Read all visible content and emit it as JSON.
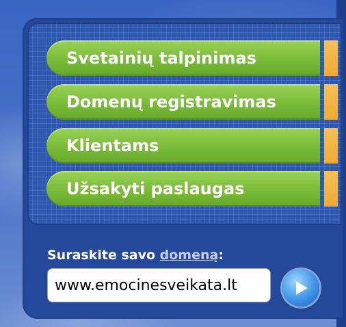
{
  "nav": {
    "items": [
      {
        "label": "Svetainių talpinimas"
      },
      {
        "label": "Domenų registravimas"
      },
      {
        "label": "Klientams"
      },
      {
        "label": "Užsakyti paslaugas"
      }
    ]
  },
  "domain_search": {
    "label_prefix": "Suraskite savo ",
    "label_link": "domeną",
    "label_suffix": ":",
    "input_value": "www.emocinesveikata.lt",
    "submit_icon": "play-arrow-icon"
  },
  "colors": {
    "nav_button": "#7fbf3c",
    "nav_tab": "#eeaa30",
    "panel": "#24489a",
    "link": "#c3cdf7"
  }
}
